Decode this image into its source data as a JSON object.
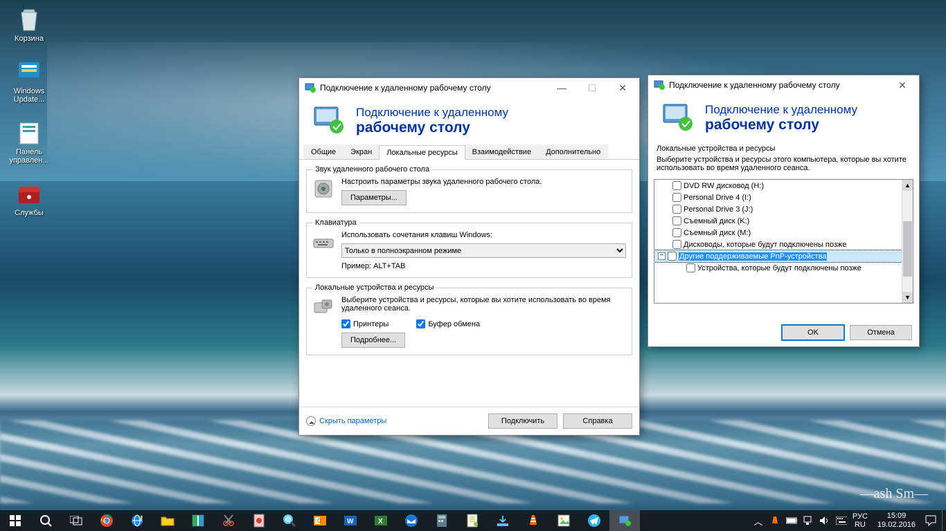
{
  "desktop": {
    "icons": [
      {
        "name": "recycle-bin",
        "label": "Корзина"
      },
      {
        "name": "windows-update",
        "label": "Windows Update..."
      },
      {
        "name": "control-panel",
        "label": "Панель управлен..."
      },
      {
        "name": "services",
        "label": "Службы"
      }
    ]
  },
  "rdp_main": {
    "title": "Подключение к удаленному рабочему столу",
    "banner_line1": "Подключение к удаленному",
    "banner_line2": "рабочему столу",
    "tabs": [
      "Общие",
      "Экран",
      "Локальные ресурсы",
      "Взаимодействие",
      "Дополнительно"
    ],
    "active_tab": 2,
    "group_audio": {
      "legend": "Звук удаленного рабочего стола",
      "desc": "Настроить параметры звука удаленного рабочего стола.",
      "btn": "Параметры..."
    },
    "group_kb": {
      "legend": "Клавиатура",
      "desc": "Использовать сочетания клавиш Windows:",
      "combo": "Только в полноэкранном режиме",
      "example": "Пример: ALT+TAB"
    },
    "group_local": {
      "legend": "Локальные устройства и ресурсы",
      "desc": "Выберите устройства и ресурсы, которые вы хотите использовать во время удаленного сеанса.",
      "chk_printers": "Принтеры",
      "chk_clipboard": "Буфер обмена",
      "btn": "Подробнее..."
    },
    "hide_options": "Скрыть параметры",
    "connect": "Подключить",
    "help": "Справка"
  },
  "rdp_more": {
    "title": "Подключение к удаленному рабочему столу",
    "banner_line1": "Подключение к удаленному",
    "banner_line2": "рабочему столу",
    "group_title": "Локальные устройства и ресурсы",
    "desc": "Выберите устройства и ресурсы этого компьютера, которые вы хотите использовать во время удаленного сеанса.",
    "tree": [
      {
        "label": "DVD RW дисковод (H:)"
      },
      {
        "label": "Personal Drive 4 (I:)"
      },
      {
        "label": "Personal Drive 3 (J:)"
      },
      {
        "label": "Съемный диск (K:)"
      },
      {
        "label": "Съемный диск (M:)"
      },
      {
        "label": "Дисководы, которые будут подключены позже"
      }
    ],
    "tree_selected": "Другие поддерживаемые PnP-устройства",
    "tree_child": "Устройства, которые будут подключены позже",
    "ok": "OK",
    "cancel": "Отмена"
  },
  "taskbar": {
    "lang_long": "РУС",
    "lang_short": "RU",
    "time": "15:09",
    "date": "19.02.2016",
    "tray_chevron": "︿"
  }
}
